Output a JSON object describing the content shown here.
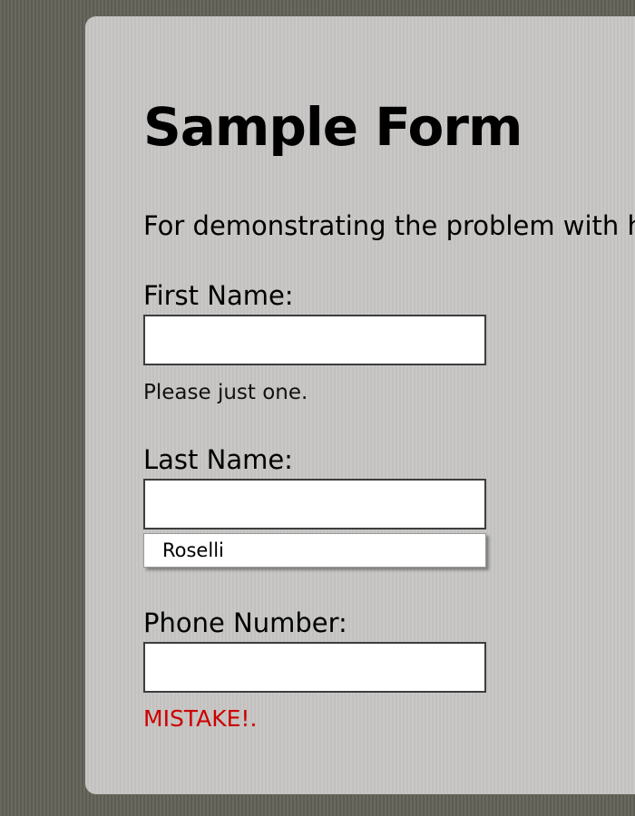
{
  "form": {
    "title": "Sample Form",
    "intro": "For demonstrating the problem with hin",
    "first_name": {
      "label": "First Name:",
      "value": "",
      "hint": "Please just one."
    },
    "last_name": {
      "label": "Last Name:",
      "value": "",
      "autocomplete_suggestion": "Roselli"
    },
    "phone": {
      "label": "Phone Number:",
      "value": "",
      "error": "MISTAKE!."
    }
  },
  "colors": {
    "page_background": "#65645a",
    "card_background": "#c6c5c3",
    "error_text": "#cc0000",
    "input_border": "#3d3d3d"
  }
}
